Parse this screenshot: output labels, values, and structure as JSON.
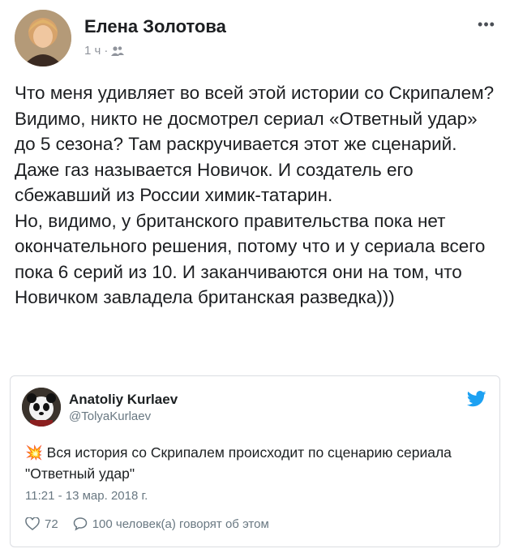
{
  "post": {
    "author": "Елена Золотова",
    "time": "1 ч",
    "separator": "·",
    "privacy_icon": "friends-icon",
    "more_label": "•••",
    "text": "Что меня удивляет во всей этой истории со Скрипалем? Видимо, никто не досмотрел сериал «Ответный удар» до 5 сезона? Там раскручивается этот же сценарий. Даже газ называется Новичок. И создатель его сбежавший из России химик-татарин.\nНо, видимо, у британского правительства пока нет окончательного решения, потому что и у сериала всего пока 6 серий из 10. И заканчиваются они на том, что Новичком завладела британская разведка)))"
  },
  "tweet": {
    "name": "Anatoliy Kurlaev",
    "handle": "@TolyaKurlaev",
    "emoji": "💥",
    "text": "Вся история со Скрипалем происходит по сценарию сериала \"Ответный удар\"",
    "timestamp": "11:21 - 13 мар. 2018 г.",
    "likes": "72",
    "replies_text": "100 человек(а) говорят об этом",
    "brand_color": "#1da1f2"
  }
}
